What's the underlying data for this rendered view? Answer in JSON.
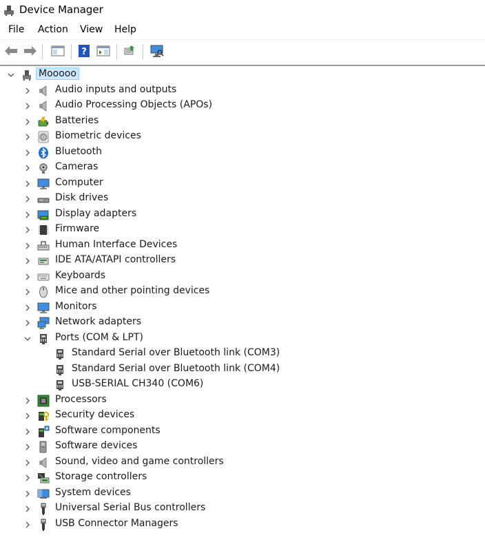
{
  "window": {
    "title": "Device Manager"
  },
  "menu": [
    "File",
    "Action",
    "View",
    "Help"
  ],
  "tree": {
    "root": "Mooooo",
    "categories": [
      {
        "label": "Audio inputs and outputs",
        "icon": "speaker-icon"
      },
      {
        "label": "Audio Processing Objects (APOs)",
        "icon": "speaker-icon"
      },
      {
        "label": "Batteries",
        "icon": "battery-icon"
      },
      {
        "label": "Biometric devices",
        "icon": "fingerprint-icon"
      },
      {
        "label": "Bluetooth",
        "icon": "bluetooth-icon"
      },
      {
        "label": "Cameras",
        "icon": "camera-icon"
      },
      {
        "label": "Computer",
        "icon": "monitor-icon"
      },
      {
        "label": "Disk drives",
        "icon": "disk-drive-icon"
      },
      {
        "label": "Display adapters",
        "icon": "display-adapter-icon"
      },
      {
        "label": "Firmware",
        "icon": "chip-icon"
      },
      {
        "label": "Human Interface Devices",
        "icon": "hid-icon"
      },
      {
        "label": "IDE ATA/ATAPI controllers",
        "icon": "ide-controller-icon"
      },
      {
        "label": "Keyboards",
        "icon": "keyboard-icon"
      },
      {
        "label": "Mice and other pointing devices",
        "icon": "mouse-icon"
      },
      {
        "label": "Monitors",
        "icon": "monitor-icon"
      },
      {
        "label": "Network adapters",
        "icon": "network-icon"
      },
      {
        "label": "Ports (COM & LPT)",
        "icon": "port-icon",
        "expanded": true,
        "children": [
          {
            "label": "Standard Serial over Bluetooth link (COM3)",
            "icon": "port-icon"
          },
          {
            "label": "Standard Serial over Bluetooth link (COM4)",
            "icon": "port-icon"
          },
          {
            "label": "USB-SERIAL CH340 (COM6)",
            "icon": "port-icon"
          }
        ]
      },
      {
        "label": "Processors",
        "icon": "processor-icon"
      },
      {
        "label": "Security devices",
        "icon": "security-icon"
      },
      {
        "label": "Software components",
        "icon": "software-component-icon"
      },
      {
        "label": "Software devices",
        "icon": "software-device-icon"
      },
      {
        "label": "Sound, video and game controllers",
        "icon": "speaker-icon"
      },
      {
        "label": "Storage controllers",
        "icon": "storage-controller-icon"
      },
      {
        "label": "System devices",
        "icon": "system-devices-icon"
      },
      {
        "label": "Universal Serial Bus controllers",
        "icon": "usb-icon"
      },
      {
        "label": "USB Connector Managers",
        "icon": "usb-icon"
      }
    ]
  },
  "colors": {
    "selection_bg": "#cce8ff",
    "selection_border": "#99d1ff",
    "accent": "#1e90ff"
  }
}
